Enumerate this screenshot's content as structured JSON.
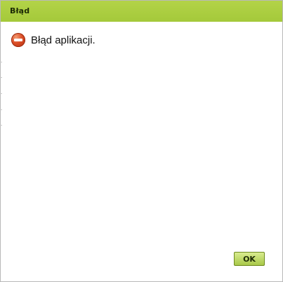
{
  "dialog": {
    "title": "Błąd",
    "message": "Błąd aplikacji.",
    "icon": "error-icon",
    "ok_label": "OK"
  },
  "colors": {
    "titlebar": "#a8cd3f",
    "button": "#b7d45a",
    "error_icon": "#d94a26"
  }
}
